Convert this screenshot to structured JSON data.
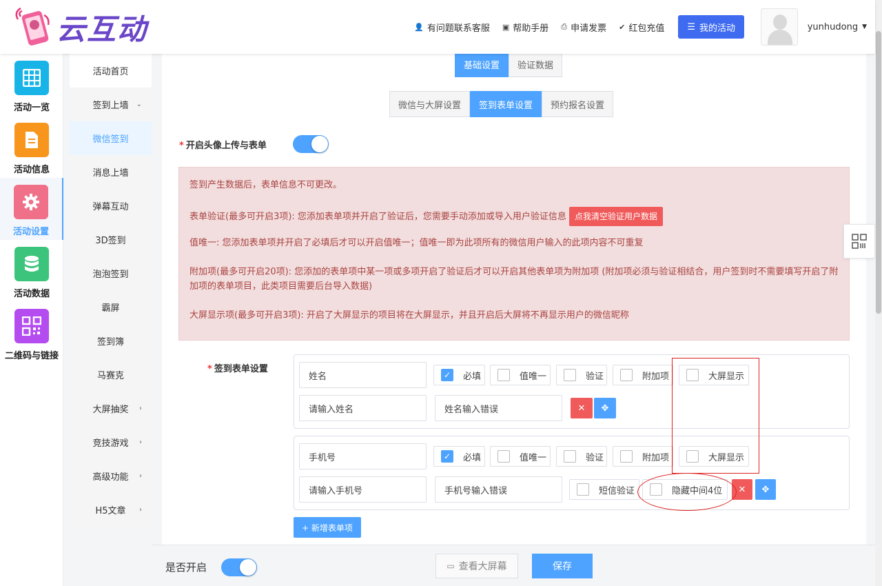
{
  "header": {
    "logo_text": "云互动",
    "links": [
      "有问题联系客服",
      "帮助手册",
      "申请发票",
      "红包充值"
    ],
    "my_activity": "我的活动",
    "username": "yunhudong"
  },
  "iconbar": [
    {
      "label": "活动一览",
      "icon": "grid-icon",
      "color": "#18b4e8"
    },
    {
      "label": "活动信息",
      "icon": "document-icon",
      "color": "#f7951d"
    },
    {
      "label": "活动设置",
      "icon": "gear-icon",
      "color": "#f0708a"
    },
    {
      "label": "活动数据",
      "icon": "database-icon",
      "color": "#3cc47c"
    },
    {
      "label": "二维码与链接",
      "icon": "qrcode-icon",
      "color": "#b44cf0"
    }
  ],
  "subnav": [
    "活动首页",
    "签到上墙",
    "微信签到",
    "消息上墙",
    "弹幕互动",
    "3D签到",
    "泡泡签到",
    "霸屏",
    "签到簿",
    "马赛克",
    "大屏抽奖",
    "竞技游戏",
    "高级功能",
    "H5文章"
  ],
  "tabs_top": [
    "基础设置",
    "验证数据"
  ],
  "tabs_sub": [
    "微信与大屏设置",
    "签到表单设置",
    "预约报名设置"
  ],
  "avatar_upload_label": "开启头像上传与表单",
  "notice": {
    "line1": "签到产生数据后，表单信息不可更改。",
    "line2": "表单验证(最多可开启3项): 您添加表单项并开启了验证后，您需要手动添加或导入用户验证信息",
    "clear_btn": "点我清空验证用户数据",
    "line3": "值唯一: 您添加表单项并开启了必填后才可以开启值唯一；值唯一即为此项所有的微信用户输入的此项内容不可重复",
    "line4": "附加项(最多可开启20项): 您添加的表单项中某一项或多项开启了验证后才可以开启其他表单项为附加项 (附加项必须与验证相结合，用户签到时不需要填写开启了附加项的表单项目，此类项目需要后台导入数据)",
    "line5": "大屏显示项(最多可开启3项): 开启了大屏显示的项目将在大屏显示，并且开启后大屏将不再显示用户的微信昵称"
  },
  "form_label": "签到表单设置",
  "options": {
    "required": "必填",
    "unique": "值唯一",
    "verify": "验证",
    "extra": "附加项",
    "display": "大屏显示"
  },
  "items": [
    {
      "name": "姓名",
      "placeholder": "请输入姓名",
      "error": "姓名输入错误"
    },
    {
      "name": "手机号",
      "placeholder": "请输入手机号",
      "error": "手机号输入错误",
      "sms": "短信验证",
      "hide_mid": "隐藏中间4位"
    }
  ],
  "add_item": "+ 新增表单项",
  "bottom": {
    "enable_label": "是否开启",
    "view_screen": "查看大屏幕",
    "save": "保存"
  }
}
